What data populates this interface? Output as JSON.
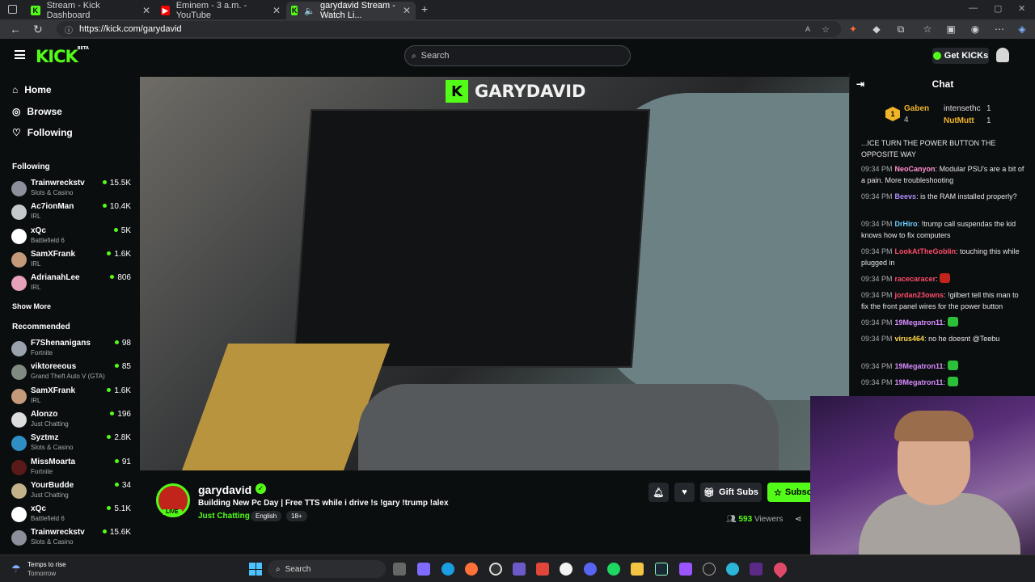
{
  "browser": {
    "tabs": [
      {
        "title": "Stream - Kick Dashboard"
      },
      {
        "title": "Eminem - 3 a.m. - YouTube"
      },
      {
        "title": "garydavid Stream - Watch Li..."
      }
    ],
    "url": "https://kick.com/garydavid"
  },
  "header": {
    "logo": "KICK",
    "logo_badge": "BETA",
    "search_placeholder": "Search",
    "get_kicks": "Get KICKs"
  },
  "sidebar": {
    "nav": [
      {
        "label": "Home",
        "icon": "home-icon"
      },
      {
        "label": "Browse",
        "icon": "compass-icon"
      },
      {
        "label": "Following",
        "icon": "heart-icon"
      }
    ],
    "following_title": "Following",
    "following": [
      {
        "name": "Trainwreckstv",
        "category": "Slots & Casino",
        "viewers": "15.5K",
        "color": "#8d8f9a"
      },
      {
        "name": "Ac7ionMan",
        "category": "IRL",
        "viewers": "10.4K",
        "color": "#c6c9cc"
      },
      {
        "name": "xQc",
        "category": "Battlefield 6",
        "viewers": "5K",
        "color": "#ffffff"
      },
      {
        "name": "SamXFrank",
        "category": "IRL",
        "viewers": "1.6K",
        "color": "#c49a7a"
      },
      {
        "name": "AdrianahLee",
        "category": "IRL",
        "viewers": "806",
        "color": "#e7a1b8"
      }
    ],
    "show_more": "Show More",
    "recommended_title": "Recommended",
    "recommended": [
      {
        "name": "F7Shenanigans",
        "category": "Fortnite",
        "viewers": "98",
        "color": "#9aa3ad"
      },
      {
        "name": "viktoreeous",
        "category": "Grand Theft Auto V (GTA)",
        "viewers": "85",
        "color": "#7f8a80"
      },
      {
        "name": "SamXFrank",
        "category": "IRL",
        "viewers": "1.6K",
        "color": "#c49a7a"
      },
      {
        "name": "Alonzo",
        "category": "Just Chatting",
        "viewers": "196",
        "color": "#dddddd"
      },
      {
        "name": "Syztmz",
        "category": "Slots & Casino",
        "viewers": "2.8K",
        "color": "#2f8fc4"
      },
      {
        "name": "MissMoarta",
        "category": "Fortnite",
        "viewers": "91",
        "color": "#5a1a1a"
      },
      {
        "name": "YourBudde",
        "category": "Just Chatting",
        "viewers": "34",
        "color": "#c2b38a"
      },
      {
        "name": "xQc",
        "category": "Battlefield 6",
        "viewers": "5.1K",
        "color": "#ffffff"
      },
      {
        "name": "Trainwreckstv",
        "category": "Slots & Casino",
        "viewers": "15.6K",
        "color": "#8d8f9a"
      }
    ]
  },
  "player": {
    "watermark": "GARYDAVID"
  },
  "stream": {
    "channel": "garydavid",
    "live_label": "LIVE",
    "title": "Building New Pc Day | Free TTS while i drive !s !gary !trump !alex",
    "category": "Just Chatting",
    "tags": [
      "English",
      "18+"
    ],
    "gift_subs": "Gift Subs",
    "subscribe": "Subsc",
    "viewers": "593",
    "viewers_label": "Viewers"
  },
  "chat": {
    "title": "Chat",
    "gifters": [
      {
        "name": "Gaben",
        "count": "4",
        "color": "#f0b429"
      },
      {
        "name": "intensethc",
        "count": "1",
        "color": "#d4d7da"
      },
      {
        "name": "NutMutt",
        "count": "1",
        "color": "#f0b429"
      }
    ],
    "messages": [
      {
        "time": "",
        "user": "",
        "text": "...ICE TURN THE POWER BUTTON THE OPPOSITE WAY",
        "color": "#ff4b4b"
      },
      {
        "time": "09:34 PM",
        "user": "NeoCanyon",
        "text": "Modular PSU's are a bit of a pain. More troubleshooting",
        "color": "#ff8fd1"
      },
      {
        "time": "09:34 PM",
        "user": "Beevs",
        "text": "is the RAM installed properly?",
        "color": "#b28bff"
      },
      {
        "time": "09:34 PM",
        "user": "DrHiro",
        "text": "!trump call suspendas the kid knows how to fix computers",
        "color": "#6ad0ff"
      },
      {
        "time": "09:34 PM",
        "user": "LookAtTheGoblin",
        "text": "touching this while plugged in",
        "color": "#ff4b6b"
      },
      {
        "time": "09:34 PM",
        "user": "racecaracer",
        "text": "",
        "color": "#ff4b6b"
      },
      {
        "time": "09:34 PM",
        "user": "jordan23owns",
        "text": "!gilbert tell this man to fix the front panel wires for the power button",
        "color": "#ff4b6b"
      },
      {
        "time": "09:34 PM",
        "user": "19Megatron11",
        "text": "",
        "color": "#d88cff"
      },
      {
        "time": "09:34 PM",
        "user": "virus464",
        "text": "no he doesnt @Teebu",
        "color": "#ffd84b"
      },
      {
        "time": "09:34 PM",
        "user": "19Megatron11",
        "text": "",
        "color": "#d88cff"
      },
      {
        "time": "09:34 PM",
        "user": "19Megatron11",
        "text": "",
        "color": "#d88cff"
      }
    ]
  },
  "taskbar": {
    "weather_title": "Temps to rise",
    "weather_sub": "Tomorrow",
    "search_label": "Search"
  },
  "colors": {
    "accent": "#53fc18",
    "bg": "#0b0e0f"
  }
}
